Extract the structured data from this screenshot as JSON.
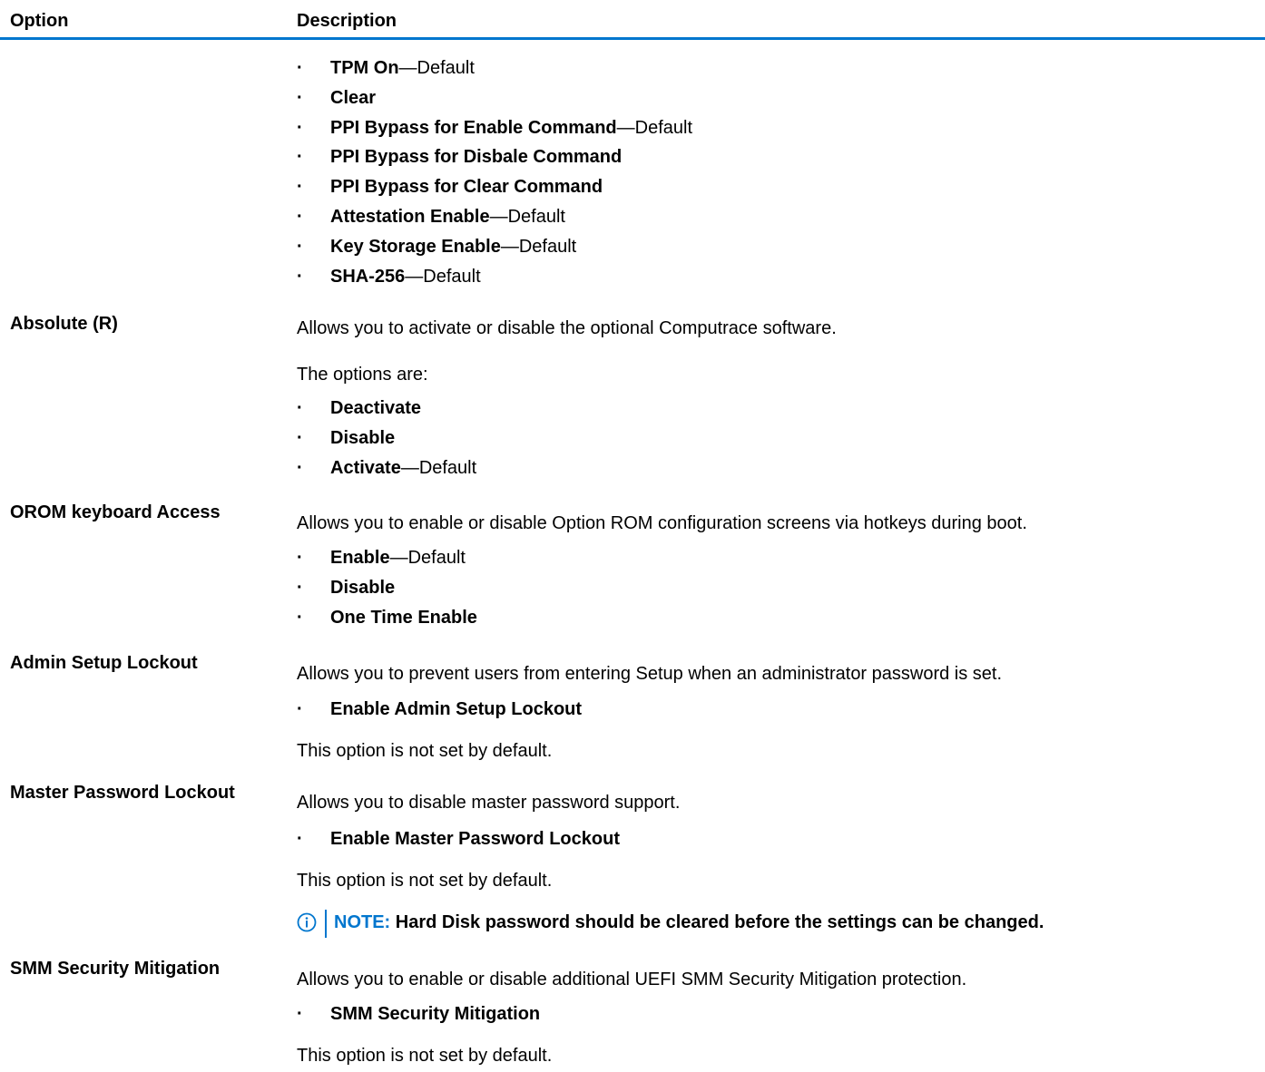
{
  "header": {
    "option": "Option",
    "description": "Description"
  },
  "tpm": {
    "items": [
      {
        "bold": "TPM On",
        "suffix": "—Default"
      },
      {
        "bold": "Clear",
        "suffix": ""
      },
      {
        "bold": "PPI Bypass for Enable Command",
        "suffix": "—Default"
      },
      {
        "bold": "PPI Bypass for Disbale Command",
        "suffix": ""
      },
      {
        "bold": "PPI Bypass for Clear Command",
        "suffix": ""
      },
      {
        "bold": "Attestation Enable",
        "suffix": "—Default"
      },
      {
        "bold": "Key Storage Enable",
        "suffix": "—Default"
      },
      {
        "bold": "SHA-256",
        "suffix": "—Default"
      }
    ]
  },
  "absolute": {
    "label": "Absolute (R)",
    "desc": "Allows you to activate or disable the optional Computrace software.",
    "intro": "The options are:",
    "items": [
      {
        "bold": "Deactivate",
        "suffix": ""
      },
      {
        "bold": "Disable",
        "suffix": ""
      },
      {
        "bold": "Activate",
        "suffix": "—Default"
      }
    ]
  },
  "orom": {
    "label": "OROM keyboard Access",
    "desc": "Allows you to enable or disable Option ROM configuration screens via hotkeys during boot.",
    "items": [
      {
        "bold": "Enable",
        "suffix": "—Default"
      },
      {
        "bold": "Disable",
        "suffix": ""
      },
      {
        "bold": "One Time Enable",
        "suffix": ""
      }
    ]
  },
  "admin": {
    "label": "Admin Setup Lockout",
    "desc": "Allows you to prevent users from entering Setup when an administrator password is set.",
    "items": [
      {
        "bold": "Enable Admin Setup Lockout",
        "suffix": ""
      }
    ],
    "footer": "This option is not set by default."
  },
  "master": {
    "label": "Master Password Lockout",
    "desc": "Allows you to disable master password support.",
    "items": [
      {
        "bold": "Enable Master Password Lockout",
        "suffix": ""
      }
    ],
    "footer": "This option is not set by default.",
    "note_label": "NOTE:",
    "note_text": " Hard Disk password should be cleared before the settings can be changed."
  },
  "smm": {
    "label": "SMM Security Mitigation",
    "desc": "Allows you to enable or disable additional UEFI SMM Security Mitigation protection.",
    "items": [
      {
        "bold": "SMM Security Mitigation",
        "suffix": ""
      }
    ],
    "footer": "This option is not set by default."
  },
  "bullet": "·",
  "colors": {
    "accent": "#0076ce"
  }
}
